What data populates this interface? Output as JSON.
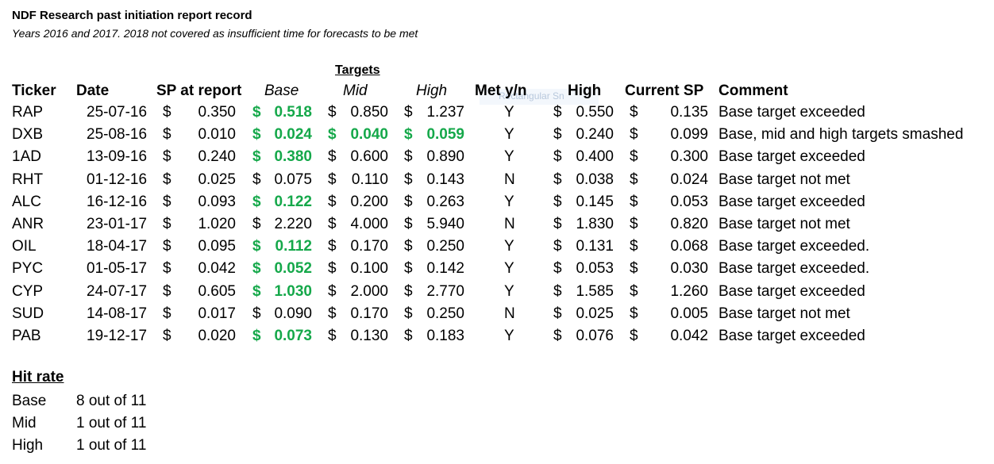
{
  "title": "NDF Research past initiation report record",
  "subtitle": "Years 2016 and 2017. 2018 not covered as insufficient time for forecasts to be met",
  "targets_label": "Targets",
  "headers": {
    "ticker": "Ticker",
    "date": "Date",
    "sp_at_report": "SP at report",
    "base": "Base",
    "mid": "Mid",
    "high": "High",
    "met": "Met y/n",
    "high2": "High",
    "current_sp": "Current SP",
    "comment": "Comment"
  },
  "ghost_label": "Rectangular Sn",
  "currency": "$",
  "rows": [
    {
      "ticker": "RAP",
      "date": "25-07-16",
      "sp": "0.350",
      "base": "0.518",
      "base_met": true,
      "mid": "0.850",
      "mid_met": false,
      "high": "1.237",
      "high_met": false,
      "met": "Y",
      "high2": "0.550",
      "current": "0.135",
      "comment": "Base target exceeded"
    },
    {
      "ticker": "DXB",
      "date": "25-08-16",
      "sp": "0.010",
      "base": "0.024",
      "base_met": true,
      "mid": "0.040",
      "mid_met": true,
      "high": "0.059",
      "high_met": true,
      "met": "Y",
      "high2": "0.240",
      "current": "0.099",
      "comment": "Base, mid and high targets smashed"
    },
    {
      "ticker": "1AD",
      "date": "13-09-16",
      "sp": "0.240",
      "base": "0.380",
      "base_met": true,
      "mid": "0.600",
      "mid_met": false,
      "high": "0.890",
      "high_met": false,
      "met": "Y",
      "high2": "0.400",
      "current": "0.300",
      "comment": "Base target exceeded"
    },
    {
      "ticker": "RHT",
      "date": "01-12-16",
      "sp": "0.025",
      "base": "0.075",
      "base_met": false,
      "mid": "0.110",
      "mid_met": false,
      "high": "0.143",
      "high_met": false,
      "met": "N",
      "high2": "0.038",
      "current": "0.024",
      "comment": "Base target not met"
    },
    {
      "ticker": "ALC",
      "date": "16-12-16",
      "sp": "0.093",
      "base": "0.122",
      "base_met": true,
      "mid": "0.200",
      "mid_met": false,
      "high": "0.263",
      "high_met": false,
      "met": "Y",
      "high2": "0.145",
      "current": "0.053",
      "comment": "Base target exceeded"
    },
    {
      "ticker": "ANR",
      "date": "23-01-17",
      "sp": "1.020",
      "base": "2.220",
      "base_met": false,
      "mid": "4.000",
      "mid_met": false,
      "high": "5.940",
      "high_met": false,
      "met": "N",
      "high2": "1.830",
      "current": "0.820",
      "comment": "Base target not met"
    },
    {
      "ticker": "OIL",
      "date": "18-04-17",
      "sp": "0.095",
      "base": "0.112",
      "base_met": true,
      "mid": "0.170",
      "mid_met": false,
      "high": "0.250",
      "high_met": false,
      "met": "Y",
      "high2": "0.131",
      "current": "0.068",
      "comment": "Base target exceeded."
    },
    {
      "ticker": "PYC",
      "date": "01-05-17",
      "sp": "0.042",
      "base": "0.052",
      "base_met": true,
      "mid": "0.100",
      "mid_met": false,
      "high": "0.142",
      "high_met": false,
      "met": "Y",
      "high2": "0.053",
      "current": "0.030",
      "comment": "Base target exceeded."
    },
    {
      "ticker": "CYP",
      "date": "24-07-17",
      "sp": "0.605",
      "base": "1.030",
      "base_met": true,
      "mid": "2.000",
      "mid_met": false,
      "high": "2.770",
      "high_met": false,
      "met": "Y",
      "high2": "1.585",
      "current": "1.260",
      "comment": "Base target exceeded"
    },
    {
      "ticker": "SUD",
      "date": "14-08-17",
      "sp": "0.017",
      "base": "0.090",
      "base_met": false,
      "mid": "0.170",
      "mid_met": false,
      "high": "0.250",
      "high_met": false,
      "met": "N",
      "high2": "0.025",
      "current": "0.005",
      "comment": "Base target not met"
    },
    {
      "ticker": "PAB",
      "date": "19-12-17",
      "sp": "0.020",
      "base": "0.073",
      "base_met": true,
      "mid": "0.130",
      "mid_met": false,
      "high": "0.183",
      "high_met": false,
      "met": "Y",
      "high2": "0.076",
      "current": "0.042",
      "comment": "Base target exceeded"
    }
  ],
  "hit_rate": {
    "title": "Hit rate",
    "items": [
      {
        "label": "Base",
        "value": "8 out of 11"
      },
      {
        "label": "Mid",
        "value": "1 out of 11"
      },
      {
        "label": "High",
        "value": "1 out of 11"
      }
    ]
  },
  "colors": {
    "met_green": "#15a84a",
    "text": "#000000",
    "background": "#ffffff"
  }
}
